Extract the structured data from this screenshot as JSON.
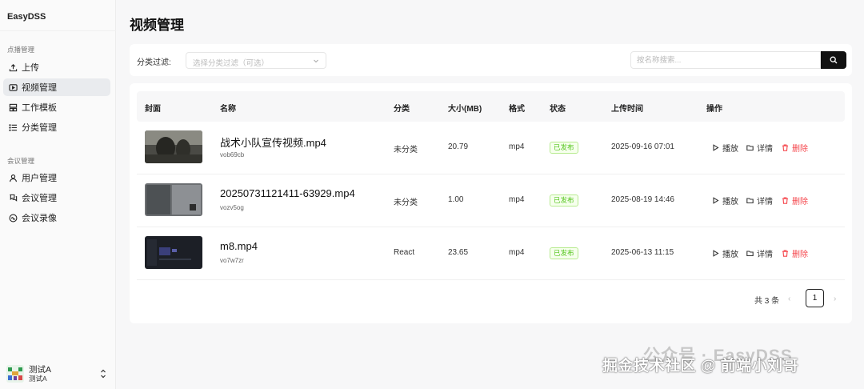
{
  "sidebar": {
    "brand": "EasyDSS",
    "groups": [
      {
        "title": "点播管理",
        "items": [
          {
            "label": "上传",
            "icon": "upload-icon"
          },
          {
            "label": "视频管理",
            "icon": "video-icon",
            "active": true
          },
          {
            "label": "工作模板",
            "icon": "template-icon"
          },
          {
            "label": "分类管理",
            "icon": "list-icon"
          }
        ]
      },
      {
        "title": "会议管理",
        "items": [
          {
            "label": "用户管理",
            "icon": "user-icon"
          },
          {
            "label": "会议管理",
            "icon": "meeting-icon"
          },
          {
            "label": "会议录像",
            "icon": "recording-icon"
          }
        ]
      }
    ],
    "user": {
      "name": "测试A",
      "sub": "测试A"
    }
  },
  "page": {
    "title": "视频管理"
  },
  "filter": {
    "label": "分类过滤:",
    "select_placeholder": "选择分类过滤（可选）",
    "search_placeholder": "按名称搜索...",
    "search_value": ""
  },
  "table": {
    "columns": [
      "封面",
      "名称",
      "分类",
      "大小(MB)",
      "格式",
      "状态",
      "上传时间",
      "操作"
    ],
    "rows": [
      {
        "name": "战术小队宣传视频.mp4",
        "id": "vob69cb",
        "category": "未分类",
        "size": "20.79",
        "format": "mp4",
        "status": "已发布",
        "time": "2025-09-16 07:01"
      },
      {
        "name": "20250731121411-63929.mp4",
        "id": "vozv5og",
        "category": "未分类",
        "size": "1.00",
        "format": "mp4",
        "status": "已发布",
        "time": "2025-08-19 14:46"
      },
      {
        "name": "m8.mp4",
        "id": "vo7w7zr",
        "category": "React",
        "size": "23.65",
        "format": "mp4",
        "status": "已发布",
        "time": "2025-06-13 11:15"
      }
    ],
    "actions": {
      "play": "播放",
      "detail": "详情",
      "delete": "删除"
    },
    "status_color": "#52c41a",
    "delete_color": "#f5454b"
  },
  "pagination": {
    "total": "共 3 条",
    "prev": "‹",
    "current": "1",
    "next": "›"
  },
  "watermark": {
    "line1": "公众号 · EasyDSS",
    "line2": "掘金技术社区 @ 前端小刘哥"
  }
}
